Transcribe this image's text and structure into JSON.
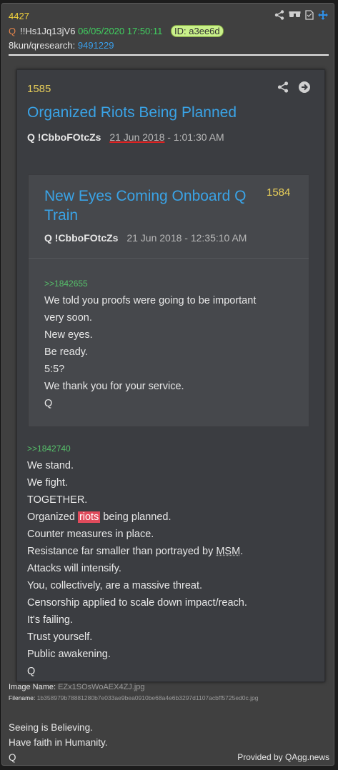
{
  "post": {
    "number": "4427",
    "author_label": "Q",
    "tripcode": "!!Hs1Jq13jV6",
    "datetime": "06/05/2020 17:50:11",
    "id": "ID: a3ee6d",
    "board_label": "8kun/qresearch:",
    "board_link": "9491229",
    "image_name_label": "Image Name:",
    "image_name": "EZx1SOsWoAEX4ZJ.jpg",
    "filename_label": "Filename:",
    "filename": "1b358979b78881280b7e033ae9bea0910be68a4e6b3297d1107acbff5725ed0c.jpg",
    "message": [
      "Seeing is Believing.",
      "Have faith in Humanity.",
      "Q"
    ],
    "provided_by": "Provided by QAgg.news"
  },
  "screenshot": {
    "number": "1585",
    "title": "Organized Riots Being Planned",
    "author": "Q",
    "trip": "!CbboFOtcZs",
    "date": "21 Jun 2018",
    "time": " - 1:01:30 AM",
    "quoted": {
      "title": "New Eyes Coming Onboard Q Train",
      "number": "1584",
      "author": "Q",
      "trip": "!CbboFOtcZs",
      "datetime": "21 Jun 2018 - 12:35:10 AM",
      "ref": ">>1842655",
      "lines": [
        "We told you proofs were going to be important",
        "very soon.",
        "New eyes.",
        "Be ready.",
        "5:5?",
        "We thank you for your service.",
        "Q"
      ]
    },
    "ref": ">>1842740",
    "lines_before": [
      "We stand.",
      "We fight.",
      "TOGETHER."
    ],
    "riots_pre": "Organized ",
    "riots_word": "riots",
    "riots_post": " being planned.",
    "counter": "Counter measures in place.",
    "resistance_pre": "Resistance far smaller than portrayed by ",
    "resistance_msm": "MSM",
    "resistance_post": ".",
    "lines_after": [
      "Attacks will intensify.",
      "You, collectively, are a massive threat.",
      "Censorship applied to scale down impact/reach.",
      "It's failing.",
      "Trust yourself.",
      "Public awakening.",
      "Q"
    ]
  },
  "colors": {
    "accent": "#3aa3e6",
    "number": "#f2d23c",
    "date": "#40d060",
    "highlight": "#e04b5c"
  },
  "icons": [
    "share-icon",
    "glasses-icon",
    "document-icon",
    "move-icon",
    "arrow-right-icon"
  ]
}
